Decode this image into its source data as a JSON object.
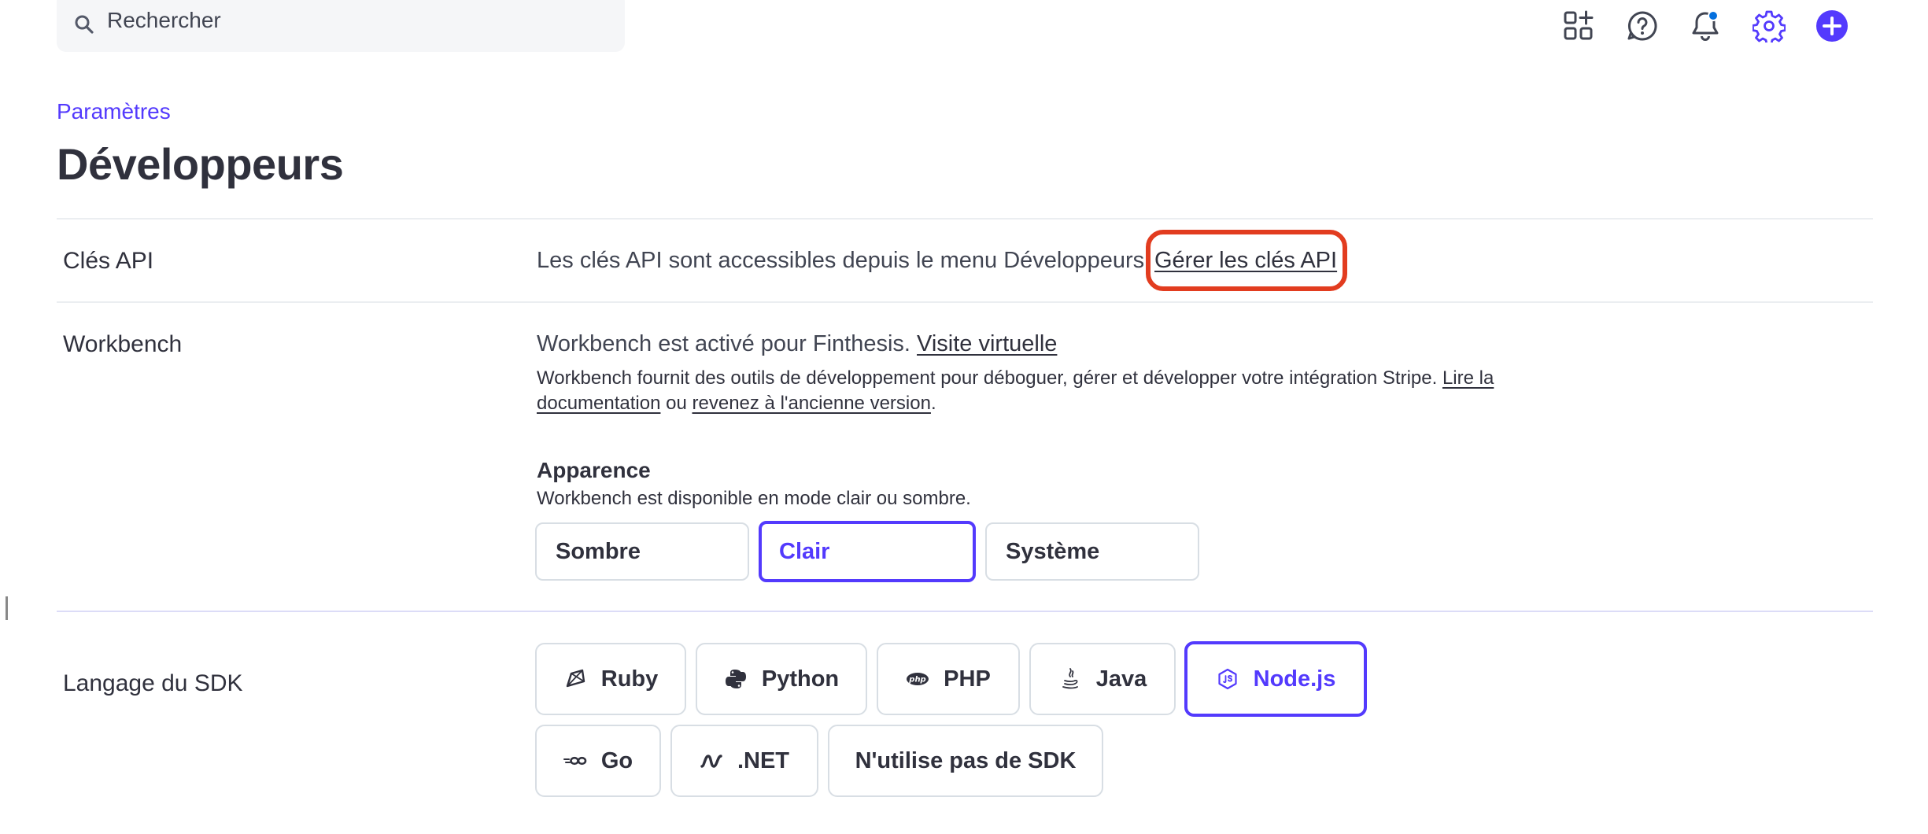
{
  "search": {
    "placeholder": "Rechercher"
  },
  "header_icons": [
    "apps-icon",
    "help-icon",
    "notifications-icon",
    "settings-icon",
    "create-icon"
  ],
  "colors": {
    "accent": "#533afd",
    "highlight": "#e23c1f",
    "text": "#30313d",
    "notification_dot": "#0570de"
  },
  "breadcrumb": "Paramètres",
  "page_title": "Développeurs",
  "api_keys": {
    "label": "Clés API",
    "text": "Les clés API sont accessibles depuis le menu Développeurs.",
    "link": "Gérer les clés API"
  },
  "workbench": {
    "label": "Workbench",
    "status_text": "Workbench est activé pour Finthesis.",
    "tour_link": "Visite virtuelle",
    "description": "Workbench fournit des outils de développement pour déboguer, gérer et développer votre intégration Stripe.",
    "docs_link_part1": "Lire la",
    "docs_link_part2": "documentation",
    "or_text": "ou",
    "old_version_link": "revenez à l'ancienne version",
    "period": "."
  },
  "appearance": {
    "title": "Apparence",
    "description": "Workbench est disponible en mode clair ou sombre.",
    "options": [
      "Sombre",
      "Clair",
      "Système"
    ],
    "selected": "Clair"
  },
  "sdk": {
    "label": "Langage du SDK",
    "options": [
      {
        "label": "Ruby",
        "icon": "ruby-icon"
      },
      {
        "label": "Python",
        "icon": "python-icon"
      },
      {
        "label": "PHP",
        "icon": "php-icon"
      },
      {
        "label": "Java",
        "icon": "java-icon"
      },
      {
        "label": "Node.js",
        "icon": "nodejs-icon"
      },
      {
        "label": "Go",
        "icon": "go-icon"
      },
      {
        "label": ".NET",
        "icon": "dotnet-icon"
      },
      {
        "label": "N'utilise pas de SDK",
        "icon": ""
      }
    ],
    "selected": "Node.js",
    "php_icon_text": "php"
  }
}
